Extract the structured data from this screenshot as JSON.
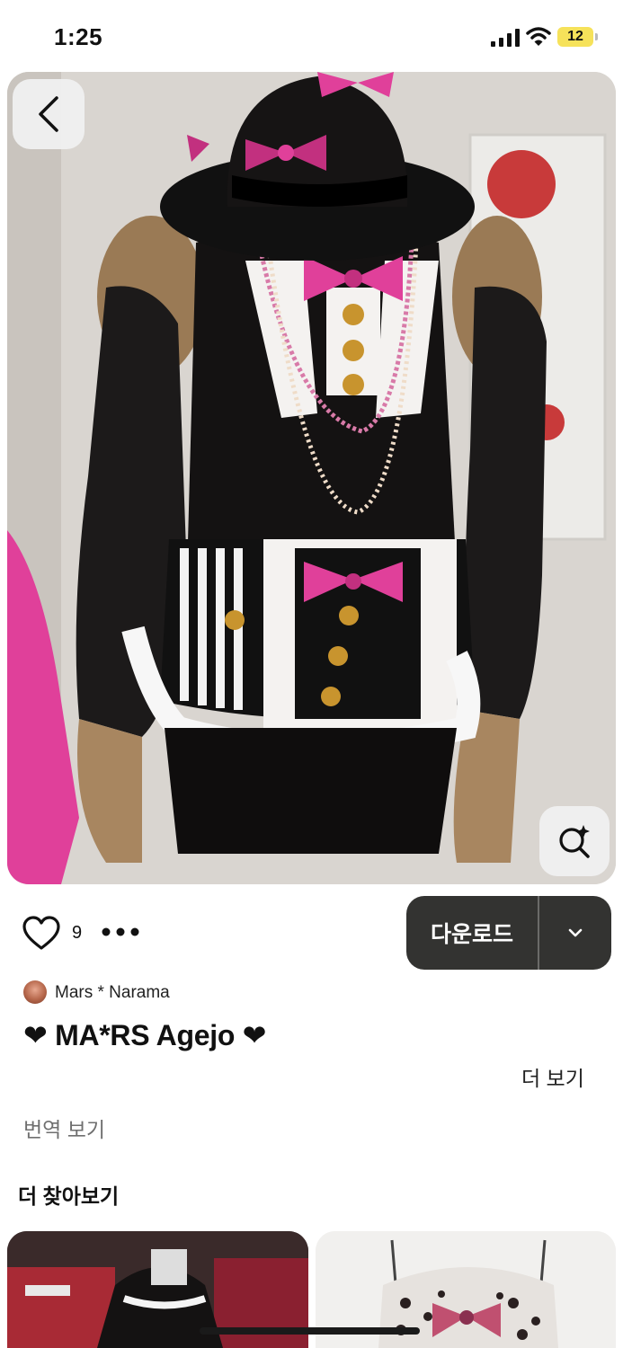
{
  "status_bar": {
    "time": "1:25",
    "battery": "12"
  },
  "pin": {
    "like_count": "9",
    "download_label": "다운로드",
    "creator": "Mars * Narama",
    "title": "❤ MA*RS Agejo ❤",
    "see_more": "더 보기",
    "translate": "번역 보기"
  },
  "more_section": {
    "title": "더 찾아보기"
  },
  "colors": {
    "download_bg": "#333331",
    "accent_pink": "#e0409a"
  }
}
